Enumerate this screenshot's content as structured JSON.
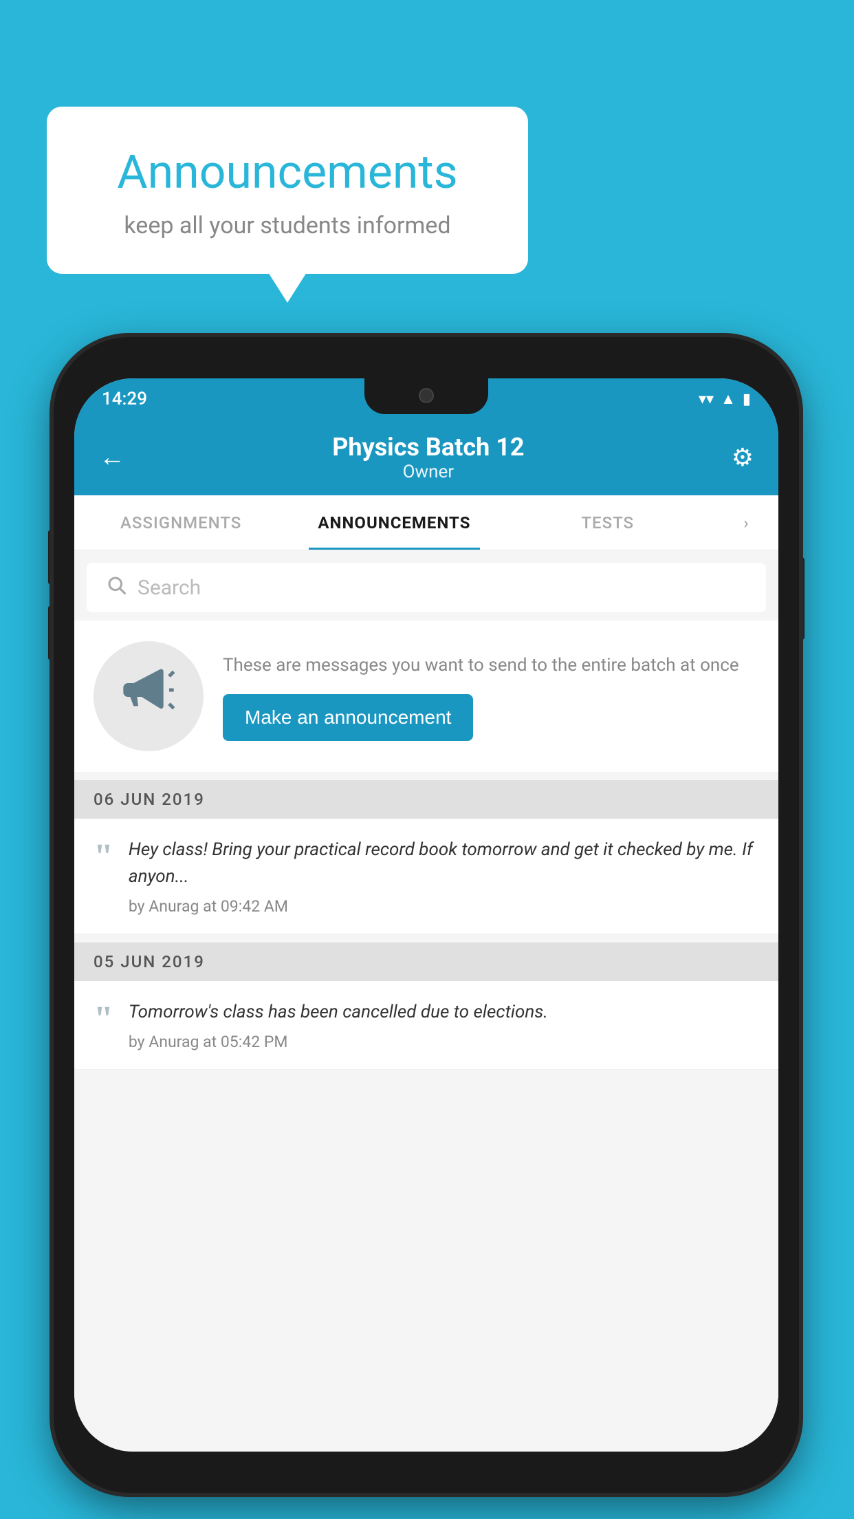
{
  "background_color": "#29b6d8",
  "speech_bubble": {
    "title": "Announcements",
    "subtitle": "keep all your students informed"
  },
  "phone": {
    "status_bar": {
      "time": "14:29",
      "wifi_icon": "▼",
      "signal_icon": "▲",
      "battery_icon": "▮"
    },
    "header": {
      "back_icon": "←",
      "title": "Physics Batch 12",
      "subtitle": "Owner",
      "gear_icon": "⚙"
    },
    "tabs": [
      {
        "label": "ASSIGNMENTS",
        "active": false
      },
      {
        "label": "ANNOUNCEMENTS",
        "active": true
      },
      {
        "label": "TESTS",
        "active": false
      },
      {
        "label": "›",
        "active": false
      }
    ],
    "search": {
      "placeholder": "Search"
    },
    "promo": {
      "description": "These are messages you want to send to the entire batch at once",
      "button_label": "Make an announcement"
    },
    "announcements": [
      {
        "date": "06  JUN  2019",
        "text": "Hey class! Bring your practical record book tomorrow and get it checked by me. If anyon...",
        "author": "by Anurag at 09:42 AM"
      },
      {
        "date": "05  JUN  2019",
        "text": "Tomorrow's class has been cancelled due to elections.",
        "author": "by Anurag at 05:42 PM"
      }
    ]
  }
}
